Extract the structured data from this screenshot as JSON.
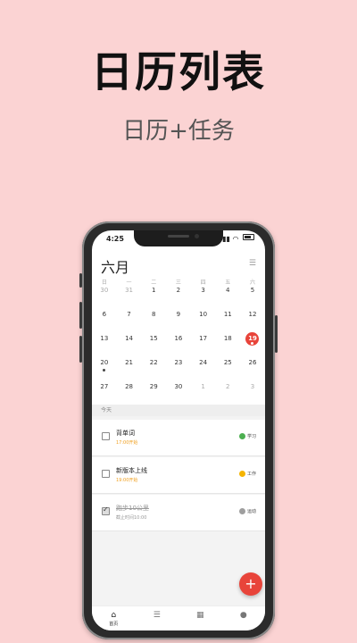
{
  "headline": "日历列表",
  "subline": "日历+任务",
  "status": {
    "time": "4:25"
  },
  "calendar": {
    "month": "六月",
    "weekdays": [
      "日",
      "一",
      "二",
      "三",
      "四",
      "五",
      "六"
    ],
    "weeks": [
      [
        "30",
        "31",
        "1",
        "2",
        "3",
        "4",
        "5"
      ],
      [
        "6",
        "7",
        "8",
        "9",
        "10",
        "11",
        "12"
      ],
      [
        "13",
        "14",
        "15",
        "16",
        "17",
        "18",
        "19"
      ],
      [
        "20",
        "21",
        "22",
        "23",
        "24",
        "25",
        "26"
      ],
      [
        "27",
        "28",
        "29",
        "30",
        "1",
        "2",
        "3"
      ]
    ],
    "selected_day": "19"
  },
  "section_label": "今天",
  "tasks": [
    {
      "title": "背单词",
      "subtitle": "17:00开始",
      "tag": "学习",
      "tag_color": "#4caf50",
      "done": false
    },
    {
      "title": "新版本上线",
      "subtitle": "19:00开始",
      "tag": "工作",
      "tag_color": "#f5b400",
      "done": false
    },
    {
      "title": "跑步10公里",
      "subtitle": "截止时间10:00",
      "tag": "运动",
      "tag_color": "#9e9e9e",
      "done": true
    }
  ],
  "fab_label": "+",
  "tabs": [
    {
      "icon": "home-icon",
      "glyph": "⌂",
      "label": "首页"
    },
    {
      "icon": "list-icon",
      "glyph": "☰",
      "label": ""
    },
    {
      "icon": "grid-icon",
      "glyph": "▦",
      "label": ""
    },
    {
      "icon": "person-icon",
      "glyph": "●",
      "label": ""
    }
  ],
  "colors": {
    "background": "#fbd3d3",
    "accent": "#e8443a",
    "pending": "#f0a020"
  }
}
